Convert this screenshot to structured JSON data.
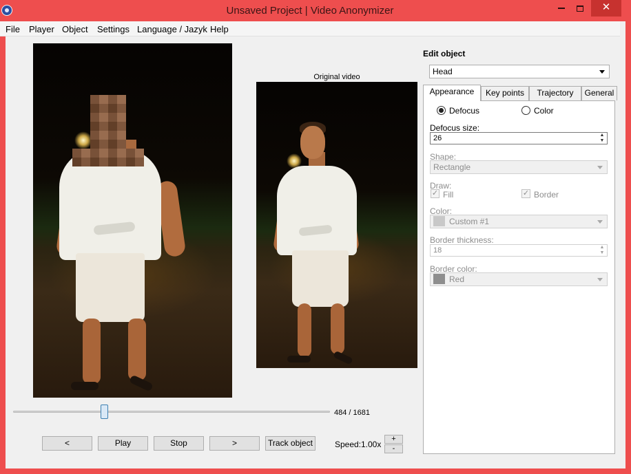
{
  "window": {
    "title": "Unsaved Project | Video Anonymizer",
    "close_glyph": "✕"
  },
  "menu": [
    "File",
    "Player",
    "Object",
    "Settings",
    "Language / Jazyk",
    "Help"
  ],
  "video": {
    "original_label": "Original video"
  },
  "player": {
    "position_fraction": 0.288,
    "frame_counter": "484 / 1681",
    "buttons": {
      "prev": "<",
      "play": "Play",
      "stop": "Stop",
      "next": ">",
      "track": "Track object"
    },
    "speed_label": "Speed:",
    "speed_value": "1.00x",
    "speed_plus": "+",
    "speed_minus": "-"
  },
  "editor": {
    "title": "Edit object",
    "object_selected": "Head",
    "tabs": [
      "Appearance",
      "Key points",
      "Trajectory",
      "General"
    ],
    "active_tab": "Appearance",
    "mode_defocus": "Defocus",
    "mode_color": "Color",
    "mode_selected": "Defocus",
    "defocus_size_label": "Defocus size:",
    "defocus_size_value": "26",
    "shape_label": "Shape:",
    "shape_value": "Rectangle",
    "draw_label": "Draw:",
    "draw_fill": "Fill",
    "draw_border": "Border",
    "color_label": "Color:",
    "color_value": "Custom #1",
    "border_thickness_label": "Border thickness:",
    "border_thickness_value": "18",
    "border_color_label": "Border color:",
    "border_color_value": "Red"
  },
  "colors": {
    "titlebar": "#ee4e4e",
    "close_button": "#c7322f",
    "color_swatch": "#c8c8c8",
    "border_color_swatch": "#8e8e8e"
  }
}
